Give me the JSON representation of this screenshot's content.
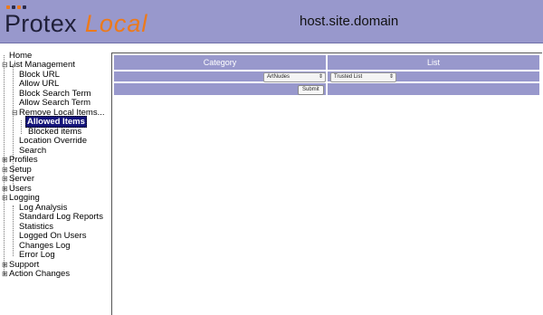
{
  "header": {
    "logo_text": "Protex",
    "logo_accent": "Local",
    "hostname": "host.site.domain"
  },
  "sidebar": {
    "items": [
      {
        "label": "Home"
      },
      {
        "label": "List Management"
      },
      {
        "label": "Block URL"
      },
      {
        "label": "Allow URL"
      },
      {
        "label": "Block Search Term"
      },
      {
        "label": "Allow Search Term"
      },
      {
        "label": "Remove Local Items..."
      },
      {
        "label": "Allowed Items"
      },
      {
        "label": "Blocked items"
      },
      {
        "label": "Location Override"
      },
      {
        "label": "Search"
      },
      {
        "label": "Profiles"
      },
      {
        "label": "Setup"
      },
      {
        "label": "Server"
      },
      {
        "label": "Users"
      },
      {
        "label": "Logging"
      },
      {
        "label": "Log Analysis"
      },
      {
        "label": "Standard Log Reports"
      },
      {
        "label": "Statistics"
      },
      {
        "label": "Logged On Users"
      },
      {
        "label": "Changes Log"
      },
      {
        "label": "Error Log"
      },
      {
        "label": "Support"
      },
      {
        "label": "Action Changes"
      }
    ]
  },
  "main": {
    "table": {
      "headers": [
        "Category",
        "List"
      ],
      "category_select": "ArtNudes",
      "list_select": "Trusted List",
      "submit_label": "Submit"
    }
  },
  "colors": {
    "header_bg": "#9898cc",
    "selected_bg": "#14147a",
    "logo_accent": "#ec7a1c"
  }
}
